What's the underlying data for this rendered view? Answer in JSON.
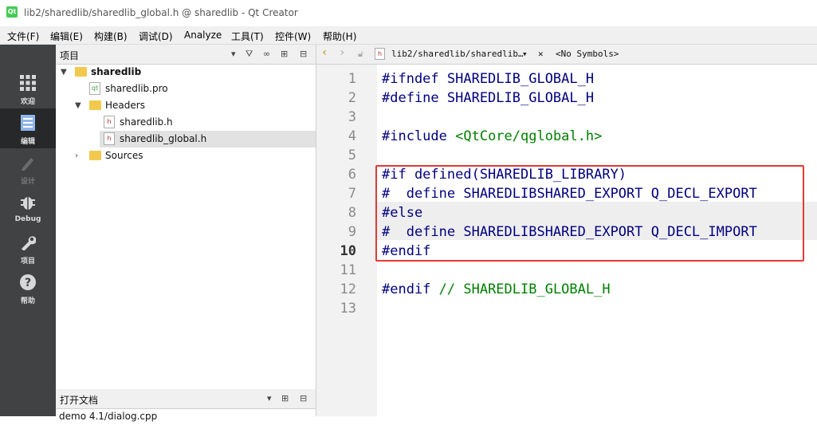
{
  "window": {
    "title": "lib2/sharedlib/sharedlib_global.h @ sharedlib - Qt Creator",
    "app_icon_text": "Qt"
  },
  "menu": [
    "文件(F)",
    "编辑(E)",
    "构建(B)",
    "调试(D)",
    "Analyze",
    "工具(T)",
    "控件(W)",
    "帮助(H)"
  ],
  "modes": [
    {
      "label": "欢迎",
      "icon": "grid-icon"
    },
    {
      "label": "编辑",
      "icon": "document-icon"
    },
    {
      "label": "设计",
      "icon": "pencil-icon"
    },
    {
      "label": "Debug",
      "icon": "bug-icon"
    },
    {
      "label": "项目",
      "icon": "wrench-icon"
    },
    {
      "label": "帮助",
      "icon": "help-icon"
    }
  ],
  "project_panel": {
    "title": "项目",
    "tree": [
      {
        "label": "sharedlib",
        "icon": "project-folder-icon"
      },
      {
        "label": "sharedlib.pro",
        "icon": "pro-file-icon"
      },
      {
        "label": "Headers",
        "icon": "header-folder-icon"
      },
      {
        "label": "sharedlib.h",
        "icon": "header-file-icon"
      },
      {
        "label": "sharedlib_global.h",
        "icon": "header-file-icon"
      },
      {
        "label": "Sources",
        "icon": "source-folder-icon"
      }
    ]
  },
  "open_documents": {
    "title": "打开文档",
    "items": [
      "demo 4.1/dialog.cpp"
    ]
  },
  "editor_toolbar": {
    "file_path": "lib2/sharedlib/sharedlib…",
    "symbols": "<No Symbols>"
  },
  "editor": {
    "current_line": "10",
    "lines": [
      {
        "no": "1",
        "text": "#ifndef SHAREDLIB_GLOBAL_H"
      },
      {
        "no": "2",
        "text": "#define SHAREDLIB_GLOBAL_H"
      },
      {
        "no": "3",
        "text": ""
      },
      {
        "no": "4",
        "text": "#include ",
        "include": "<QtCore/qglobal.h>"
      },
      {
        "no": "5",
        "text": ""
      },
      {
        "no": "6",
        "text": "#if defined(SHAREDLIB_LIBRARY)"
      },
      {
        "no": "7",
        "text": "#  define SHAREDLIBSHARED_EXPORT Q_DECL_EXPORT"
      },
      {
        "no": "8",
        "text": "#else"
      },
      {
        "no": "9",
        "text": "#  define SHAREDLIBSHARED_EXPORT Q_DECL_IMPORT"
      },
      {
        "no": "10",
        "text": "#endif"
      },
      {
        "no": "11",
        "text": ""
      },
      {
        "no": "12",
        "text": "#endif ",
        "comment": "// SHAREDLIB_GLOBAL_H"
      },
      {
        "no": "13",
        "text": ""
      }
    ]
  },
  "colors": {
    "modebar": "#404244",
    "highlight_box": "#e53935",
    "keyword": "#000080",
    "string": "#008000"
  }
}
